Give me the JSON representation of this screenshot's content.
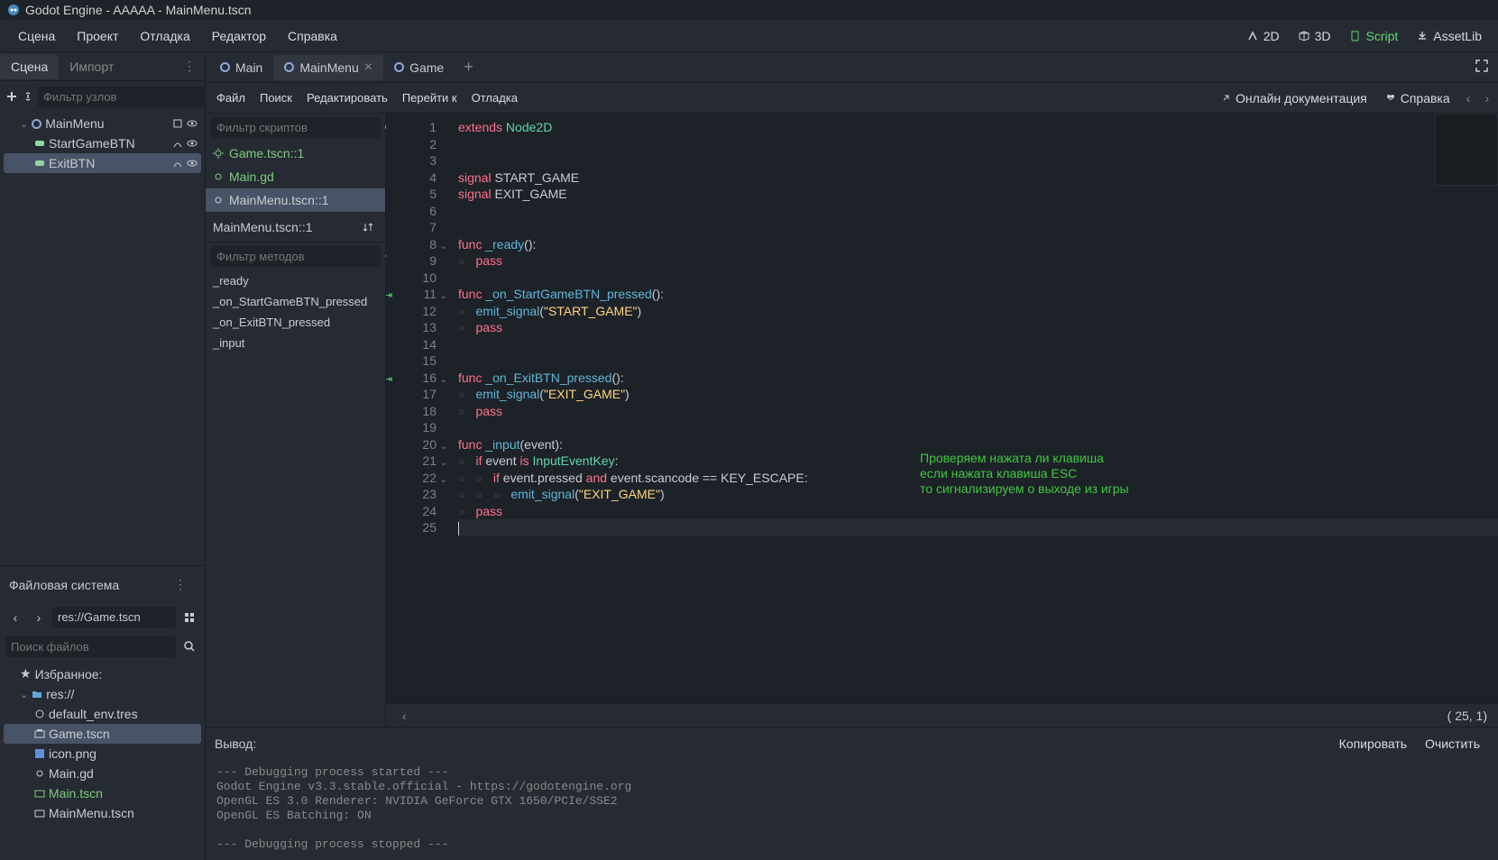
{
  "title": "Godot Engine - AAAAA - MainMenu.tscn",
  "menubar": {
    "scene": "Сцена",
    "project": "Проект",
    "debug": "Отладка",
    "editor": "Редактор",
    "help": "Справка"
  },
  "workspaces": {
    "twod": "2D",
    "threed": "3D",
    "script": "Script",
    "assetlib": "AssetLib"
  },
  "scene_panel": {
    "tab_scene": "Сцена",
    "tab_import": "Импорт",
    "filter": "Фильтр узлов",
    "root": "MainMenu",
    "child1": "StartGameBTN",
    "child2": "ExitBTN"
  },
  "fs": {
    "title": "Файловая система",
    "path": "res://Game.tscn",
    "search": "Поиск файлов",
    "fav": "Избранное:",
    "root": "res://",
    "items": [
      "default_env.tres",
      "Game.tscn",
      "icon.png",
      "Main.gd",
      "Main.tscn",
      "MainMenu.tscn"
    ]
  },
  "scene_tabs": {
    "main": "Main",
    "mainmenu": "MainMenu",
    "game": "Game"
  },
  "script_menu": {
    "file": "Файл",
    "search": "Поиск",
    "edit": "Редактировать",
    "goto": "Перейти к",
    "debug": "Отладка",
    "online": "Онлайн документация",
    "help": "Справка"
  },
  "script_filter": "Фильтр скриптов",
  "scripts": {
    "s1": "Game.tscn::1",
    "s2": "Main.gd",
    "s3": "MainMenu.tscn::1"
  },
  "method_header": "MainMenu.tscn::1",
  "method_filter": "Фильтр методов",
  "methods": {
    "m1": "_ready",
    "m2": "_on_StartGameBTN_pressed",
    "m3": "_on_ExitBTN_pressed",
    "m4": "_input"
  },
  "code": {
    "l1_kw": "extends",
    "l1_cls": " Node2D",
    "l4_kw": "signal",
    "l4_t": " START_GAME",
    "l5_kw": "signal",
    "l5_t": " EXIT_GAME",
    "l8_kw": "func ",
    "l8_fn": "_ready",
    "l8_t": "():",
    "l9_t": "    ",
    "l9_kw": "pass",
    "l11_kw": "func ",
    "l11_fn": "_on_StartGameBTN_pressed",
    "l11_t": "():",
    "l12_t": "    ",
    "l12_fn": "emit_signal",
    "l12_p": "(",
    "l12_str": "\"START_GAME\"",
    "l12_cp": ")",
    "l13_t": "    ",
    "l13_kw": "pass",
    "l16_kw": "func ",
    "l16_fn": "_on_ExitBTN_pressed",
    "l16_t": "():",
    "l17_t": "    ",
    "l17_fn": "emit_signal",
    "l17_p": "(",
    "l17_str": "\"EXIT_GAME\"",
    "l17_cp": ")",
    "l18_t": "    ",
    "l18_kw": "pass",
    "l20_kw": "func ",
    "l20_fn": "_input",
    "l20_p": "(event):",
    "l21_t": "    ",
    "l21_kw": "if",
    "l21_a": " event ",
    "l21_is": "is",
    "l21_cls": " InputEventKey",
    "l21_c": ":",
    "l22_t": "        ",
    "l22_kw": "if",
    "l22_a": " event.pressed ",
    "l22_and": "and",
    "l22_b": " event.scancode == KEY_ESCAPE:",
    "l23_t": "            ",
    "l23_fn": "emit_signal",
    "l23_p": "(",
    "l23_str": "\"EXIT_GAME\"",
    "l23_cp": ")",
    "l24_t": "    ",
    "l24_kw": "pass"
  },
  "annotation": {
    "l1": "Проверяем нажата ли клавиша",
    "l2": "если нажата клавиша ESC",
    "l3": "то сигнализируем о выходе из игры"
  },
  "status": {
    "pos": "( 25,  1)"
  },
  "output": {
    "title": "Вывод:",
    "copy": "Копировать",
    "clear": "Очистить",
    "text": "--- Debugging process started ---\nGodot Engine v3.3.stable.official - https://godotengine.org\nOpenGL ES 3.0 Renderer: NVIDIA GeForce GTX 1650/PCIe/SSE2\nOpenGL ES Batching: ON\n \n--- Debugging process stopped ---"
  }
}
